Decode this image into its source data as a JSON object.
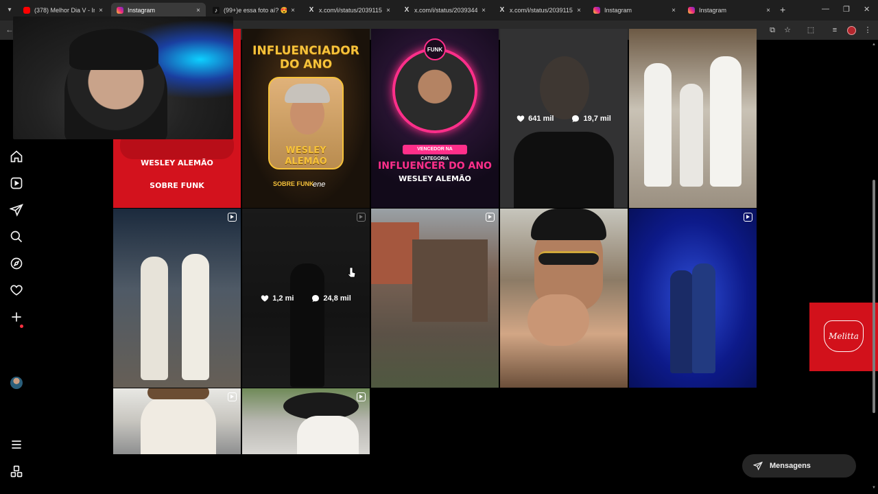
{
  "browser": {
    "tabs": [
      {
        "title": "(378) Melhor Dia V - Ines",
        "favicon": "youtube-icon",
        "active": false
      },
      {
        "title": "Instagram",
        "favicon": "instagram-icon",
        "active": true
      },
      {
        "title": "(99+)e essa foto aí? 😍😍",
        "favicon": "tiktok-icon",
        "active": false
      },
      {
        "title": "x.com/i/status/20391155",
        "favicon": "x-icon",
        "active": false
      },
      {
        "title": "x.com/i/status/20393449",
        "favicon": "x-icon",
        "active": false
      },
      {
        "title": "x.com/i/status/20391155",
        "favicon": "x-icon",
        "active": false
      },
      {
        "title": "Instagram",
        "favicon": "instagram-icon",
        "active": false
      },
      {
        "title": "Instagram",
        "favicon": "instagram-icon",
        "active": false
      }
    ],
    "new_tab": "+",
    "close_glyph": "×"
  },
  "posts": {
    "row1": [
      {
        "kind": "poster-red",
        "text": "WESLEY ALEMÃO",
        "brand": "SOBRE FUNK"
      },
      {
        "kind": "poster-influencer",
        "title_line1": "INFLUENCIADOR",
        "title_line2": "DO ANO",
        "name_line1": "WESLEY",
        "name_line2": "ALEMÃO",
        "brand": "SOBRE FUNK",
        "partner": "ene"
      },
      {
        "kind": "poster-funk",
        "badge": "FUNK",
        "category": "VENCEDOR NA CATEGORIA",
        "title": "INFLUENCER DO ANO",
        "name": "WESLEY ALEMÃO"
      },
      {
        "kind": "hovered",
        "likes": "641 mil",
        "comments": "19,7 mil"
      },
      {
        "kind": "photo-bar"
      }
    ],
    "row2": [
      {
        "kind": "reel-party"
      },
      {
        "kind": "hovered-reel",
        "likes": "1,2 mi",
        "comments": "24,8 mil"
      },
      {
        "kind": "reel-slum"
      },
      {
        "kind": "photo-beach"
      },
      {
        "kind": "reel-stage"
      }
    ],
    "row3": [
      {
        "kind": "reel-cowboy"
      },
      {
        "kind": "reel-cowboy-hat"
      }
    ]
  },
  "ad": {
    "brand": "Melitta",
    "color": "#d2111b"
  },
  "messages": {
    "label": "Mensagens"
  },
  "colors": {
    "background": "#000000",
    "accent_red": "#d3121d",
    "gold": "#f6c23a",
    "pink": "#ff2f8a",
    "notification": "#ff3040"
  }
}
